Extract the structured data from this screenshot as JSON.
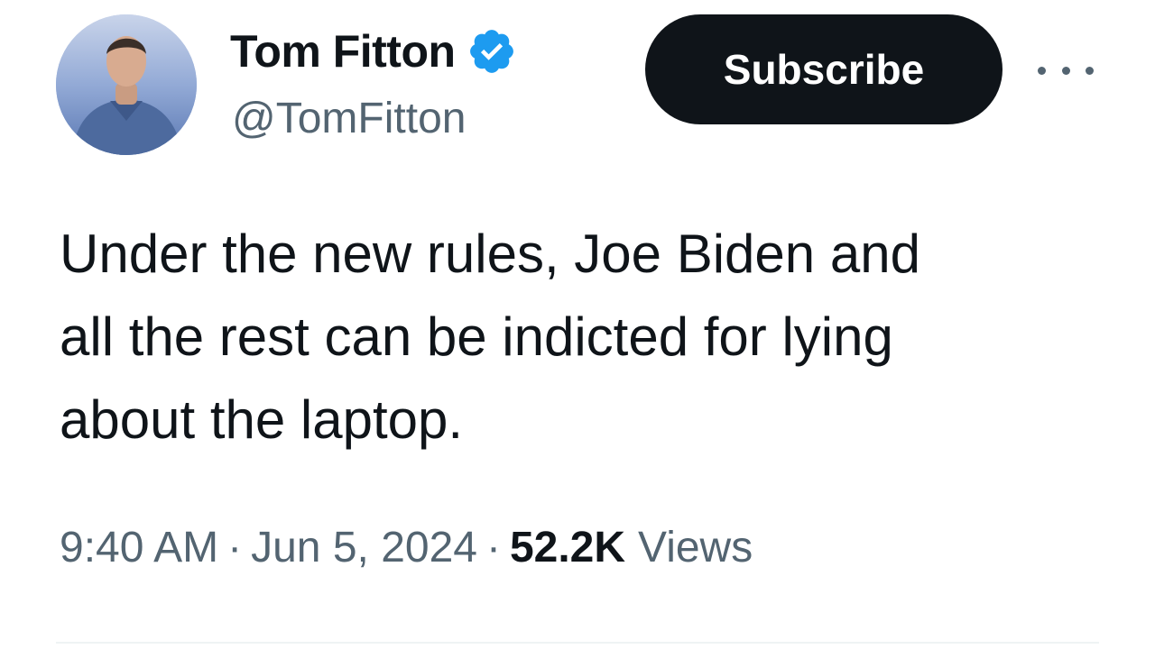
{
  "author": {
    "display_name": "Tom Fitton",
    "handle": "@TomFitton",
    "verified": true,
    "avatar_icon": "profile-photo"
  },
  "subscribe_label": "Subscribe",
  "more_icon": "ellipsis-icon",
  "tweet": {
    "lines": [
      "Under the new rules, Joe Biden and",
      "all the rest can be indicted for lying",
      "about the laptop."
    ]
  },
  "meta": {
    "time": "9:40 AM",
    "separator": "·",
    "date": "Jun 5, 2024",
    "views_count": "52.2K",
    "views_label": "Views"
  },
  "colors": {
    "text_primary": "#0f1419",
    "text_secondary": "#536471",
    "verified_blue": "#1d9bf0",
    "button_bg": "#0f1419"
  }
}
